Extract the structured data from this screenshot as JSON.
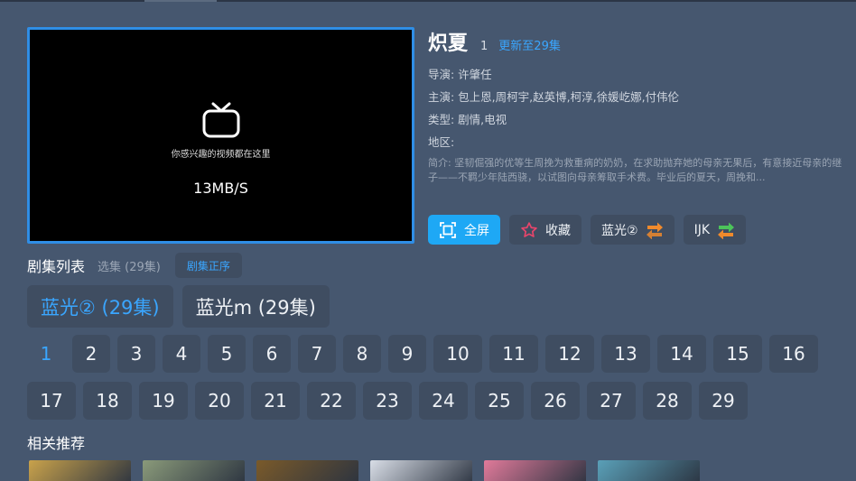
{
  "player": {
    "hint": "你感兴趣的视频都在这里",
    "speed": "13MB/S"
  },
  "info": {
    "title": "炽夏",
    "number": "1",
    "update": "更新至29集",
    "director": "导演: 许肇任",
    "cast": "主演: 包上恩,周柯宇,赵英博,柯淳,徐媛屹娜,付伟伦",
    "genre": "类型: 剧情,电视",
    "region": "地区:",
    "description": "简介: 坚韧倔强的优等生周挽为救重病的奶奶，在求助抛弃她的母亲无果后，有意接近母亲的继子——不羁少年陆西骁，以试图向母亲筹取手术费。毕业后的夏天，周挽和..."
  },
  "actions": {
    "fullscreen": "全屏",
    "favorite": "收藏",
    "source": "蓝光②",
    "player": "IJK"
  },
  "episodes_header": {
    "title": "剧集列表",
    "select": "选集 (29集)",
    "order": "剧集正序"
  },
  "sources": [
    {
      "label": "蓝光② (29集)"
    },
    {
      "label": "蓝光m (29集)"
    }
  ],
  "episodes": [
    "1",
    "2",
    "3",
    "4",
    "5",
    "6",
    "7",
    "8",
    "9",
    "10",
    "11",
    "12",
    "13",
    "14",
    "15",
    "16",
    "17",
    "18",
    "19",
    "20",
    "21",
    "22",
    "23",
    "24",
    "25",
    "26",
    "27",
    "28",
    "29"
  ],
  "current_episode": "1",
  "recommend_title": "相关推荐",
  "recommend_colors": [
    "#c9a24b",
    "#8a9a7a",
    "#7a5a2a",
    "#d8dde6",
    "#e07a9a",
    "#5aa0b8"
  ]
}
